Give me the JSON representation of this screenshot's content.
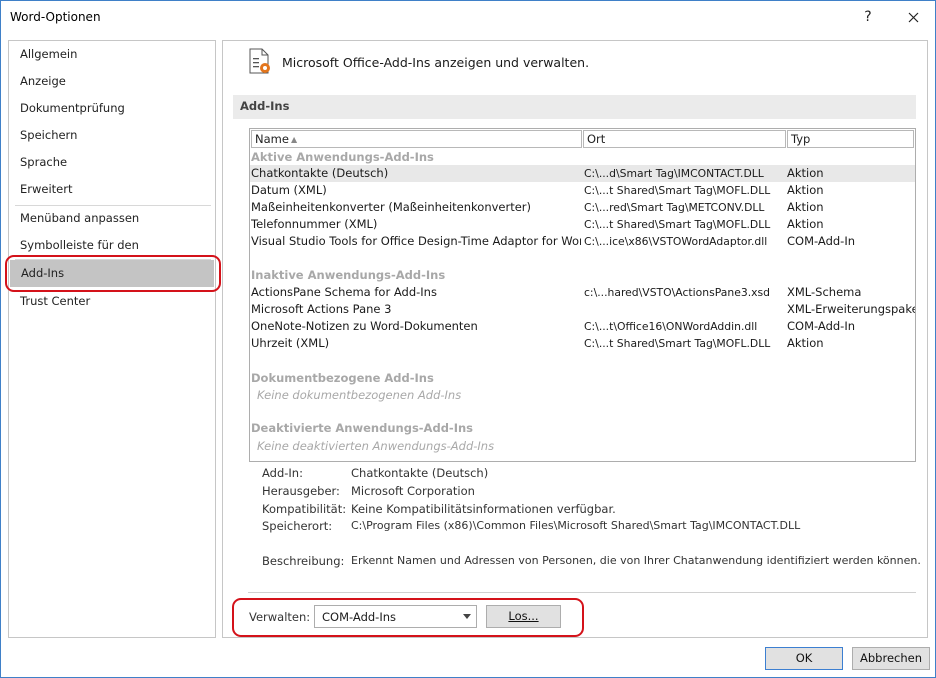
{
  "window": {
    "title": "Word-Optionen",
    "help": "?"
  },
  "sidebar": {
    "items": [
      {
        "label": "Allgemein"
      },
      {
        "label": "Anzeige"
      },
      {
        "label": "Dokumentprüfung"
      },
      {
        "label": "Speichern"
      },
      {
        "label": "Sprache"
      },
      {
        "label": "Erweitert"
      },
      {
        "label": "Menüband anpassen"
      },
      {
        "label": "Symbolleiste für den Schnellzugriff"
      },
      {
        "label": "Add-Ins"
      },
      {
        "label": "Trust Center"
      }
    ],
    "active": "Add-Ins"
  },
  "header": {
    "text": "Microsoft Office-Add-Ins anzeigen und verwalten."
  },
  "section": {
    "title": "Add-Ins"
  },
  "table": {
    "columns": {
      "name": "Name",
      "ort": "Ort",
      "typ": "Typ"
    },
    "groups": {
      "active": {
        "label": "Aktive Anwendungs-Add-Ins",
        "rows": [
          {
            "name": "Chatkontakte (Deutsch)",
            "ort": "C:\\...d\\Smart Tag\\IMCONTACT.DLL",
            "typ": "Aktion",
            "selected": true
          },
          {
            "name": "Datum (XML)",
            "ort": "C:\\...t Shared\\Smart Tag\\MOFL.DLL",
            "typ": "Aktion"
          },
          {
            "name": "Maßeinheitenkonverter (Maßeinheitenkonverter)",
            "ort": "C:\\...red\\Smart Tag\\METCONV.DLL",
            "typ": "Aktion"
          },
          {
            "name": "Telefonnummer (XML)",
            "ort": "C:\\...t Shared\\Smart Tag\\MOFL.DLL",
            "typ": "Aktion"
          },
          {
            "name": "Visual Studio Tools for Office Design-Time Adaptor for Word",
            "ort": "C:\\...ice\\x86\\VSTOWordAdaptor.dll",
            "typ": "COM-Add-In"
          }
        ]
      },
      "inactive": {
        "label": "Inaktive Anwendungs-Add-Ins",
        "rows": [
          {
            "name": "ActionsPane Schema for Add-Ins",
            "ort": "c:\\...hared\\VSTO\\ActionsPane3.xsd",
            "typ": "XML-Schema"
          },
          {
            "name": "Microsoft Actions Pane 3",
            "ort": "",
            "typ": "XML-Erweiterungspaket"
          },
          {
            "name": "OneNote-Notizen zu Word-Dokumenten",
            "ort": "C:\\...t\\Office16\\ONWordAddin.dll",
            "typ": "COM-Add-In"
          },
          {
            "name": "Uhrzeit (XML)",
            "ort": "C:\\...t Shared\\Smart Tag\\MOFL.DLL",
            "typ": "Aktion"
          }
        ]
      },
      "document": {
        "label": "Dokumentbezogene Add-Ins",
        "empty": "Keine dokumentbezogenen Add-Ins"
      },
      "disabled": {
        "label": "Deaktivierte Anwendungs-Add-Ins",
        "empty": "Keine deaktivierten Anwendungs-Add-Ins"
      }
    }
  },
  "details": {
    "addin_label": "Add-In:",
    "addin_value": "Chatkontakte (Deutsch)",
    "publisher_label": "Herausgeber:",
    "publisher_value": "Microsoft Corporation",
    "compat_label": "Kompatibilität:",
    "compat_value": "Keine Kompatibilitätsinformationen verfügbar.",
    "location_label": "Speicherort:",
    "location_value": "C:\\Program Files (x86)\\Common Files\\Microsoft Shared\\Smart Tag\\IMCONTACT.DLL",
    "desc_label": "Beschreibung:",
    "desc_value": "Erkennt Namen und Adressen von Personen, die von Ihrer Chatanwendung identifiziert werden können."
  },
  "manage": {
    "label": "Verwalten:",
    "selected": "COM-Add-Ins",
    "go_label": "Los..."
  },
  "footer": {
    "ok_label": "OK",
    "cancel_label": "Abbrechen"
  },
  "colors": {
    "highlight": "#d4121a",
    "selected_nav": "#c4c4c4",
    "window_border": "#3f80c8"
  }
}
